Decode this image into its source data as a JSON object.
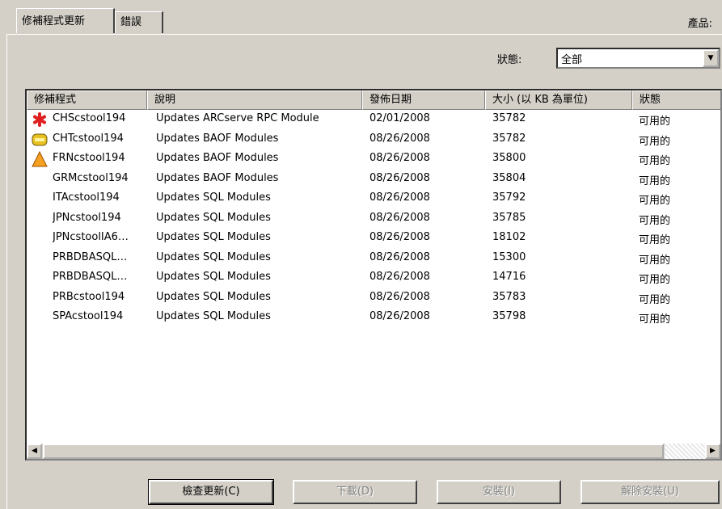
{
  "tabs": [
    {
      "label": "修補程式更新",
      "active": true
    },
    {
      "label": "錯誤",
      "active": false
    }
  ],
  "product_label": "產品:",
  "status_filter": {
    "label": "狀態:",
    "value": "全部"
  },
  "columns": [
    "修補程式",
    "說明",
    "發佈日期",
    "大小 (以 KB 為單位)",
    "狀態"
  ],
  "rows": [
    {
      "icon": "red-asterisk-icon",
      "name": "CHScstool194",
      "desc": "Updates ARCserve RPC Module",
      "date": "02/01/2008",
      "size": "35782",
      "status": "可用的"
    },
    {
      "icon": "yellow-pill-icon",
      "name": "CHTcstool194",
      "desc": "Updates BAOF Modules",
      "date": "08/26/2008",
      "size": "35782",
      "status": "可用的"
    },
    {
      "icon": "warning-triangle-icon",
      "name": "FRNcstool194",
      "desc": "Updates BAOF Modules",
      "date": "08/26/2008",
      "size": "35800",
      "status": "可用的"
    },
    {
      "icon": "",
      "name": "GRMcstool194",
      "desc": "Updates BAOF Modules",
      "date": "08/26/2008",
      "size": "35804",
      "status": "可用的"
    },
    {
      "icon": "",
      "name": "ITAcstool194",
      "desc": "Updates SQL Modules",
      "date": "08/26/2008",
      "size": "35792",
      "status": "可用的"
    },
    {
      "icon": "",
      "name": "JPNcstool194",
      "desc": "Updates SQL Modules",
      "date": "08/26/2008",
      "size": "35785",
      "status": "可用的"
    },
    {
      "icon": "",
      "name": "JPNcstoolIA6…",
      "desc": "Updates SQL Modules",
      "date": "08/26/2008",
      "size": "18102",
      "status": "可用的"
    },
    {
      "icon": "",
      "name": "PRBDBASQL…",
      "desc": "Updates SQL Modules",
      "date": "08/26/2008",
      "size": "15300",
      "status": "可用的"
    },
    {
      "icon": "",
      "name": "PRBDBASQL…",
      "desc": "Updates SQL Modules",
      "date": "08/26/2008",
      "size": "14716",
      "status": "可用的"
    },
    {
      "icon": "",
      "name": "PRBcstool194",
      "desc": "Updates SQL Modules",
      "date": "08/26/2008",
      "size": "35783",
      "status": "可用的"
    },
    {
      "icon": "",
      "name": "SPAcstool194",
      "desc": "Updates SQL Modules",
      "date": "08/26/2008",
      "size": "35798",
      "status": "可用的"
    }
  ],
  "buttons": {
    "check_updates": "檢查更新(C)",
    "download": "下載(D)",
    "install": "安裝(I)",
    "uninstall": "解除安裝(U)"
  },
  "colors": {
    "window_bg": "#d4d0c8",
    "disabled_text": "#808080"
  }
}
